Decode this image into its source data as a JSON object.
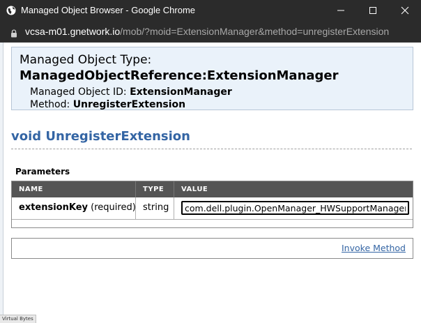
{
  "window": {
    "title": "Managed Object Browser - Google Chrome"
  },
  "address": {
    "host": "vcsa-m01.gnetwork.io",
    "path": "/mob/?moid=ExtensionManager&method=unregisterExtension"
  },
  "header": {
    "type_label": "Managed Object Type:",
    "type_value": "ManagedObjectReference:ExtensionManager",
    "id_label": "Managed Object ID:",
    "id_value": "ExtensionManager",
    "method_label": "Method:",
    "method_value": "UnregisterExtension"
  },
  "method_signature": "void UnregisterExtension",
  "parameters": {
    "label": "Parameters",
    "columns": [
      "NAME",
      "TYPE",
      "VALUE"
    ],
    "rows": [
      {
        "name": "extensionKey",
        "qualifier": "(required)",
        "type": "string",
        "value": "com.dell.plugin.OpenManager_HWSupportManager"
      }
    ]
  },
  "invoke_label": "Invoke Method",
  "status_text": "Virtual Bytes",
  "colors": {
    "link": "#3465a4",
    "header_bg": "#eaf2fa",
    "table_head_bg": "#555555",
    "chrome_bg": "#2b2b2b"
  }
}
